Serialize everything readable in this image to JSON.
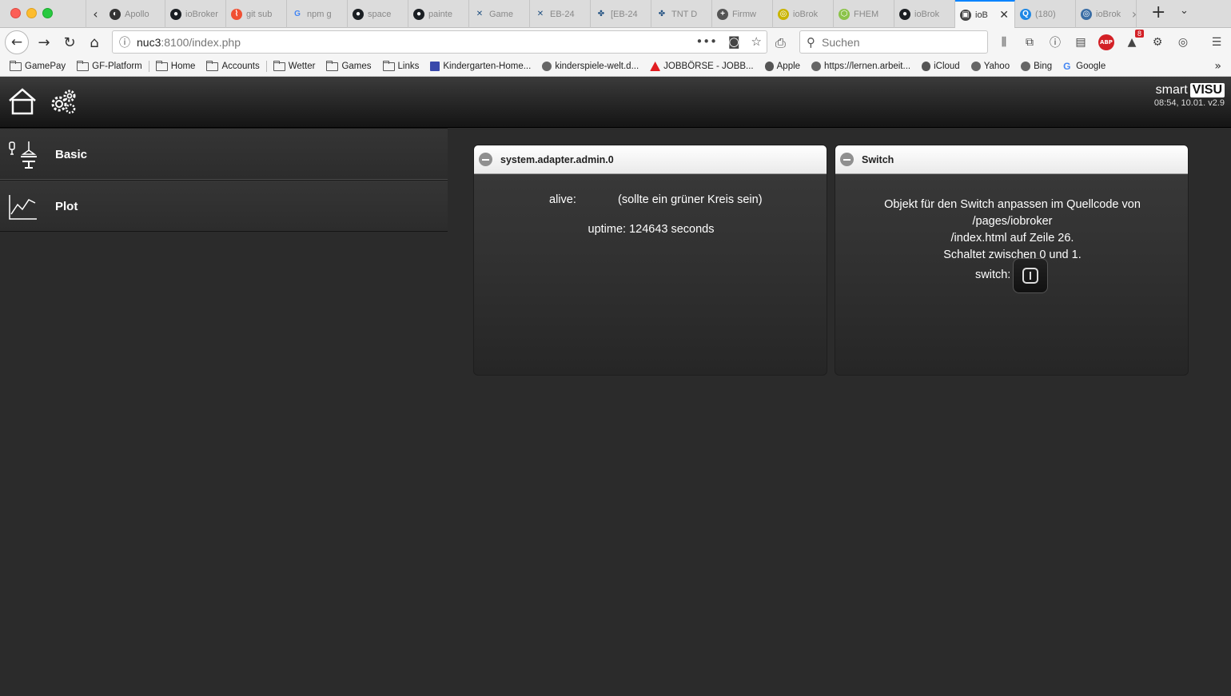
{
  "browser": {
    "tabs": [
      {
        "label": "Apollo",
        "icon": "apollo"
      },
      {
        "label": "ioBroker",
        "icon": "github"
      },
      {
        "label": "git sub",
        "icon": "git"
      },
      {
        "label": "npm g",
        "icon": "google"
      },
      {
        "label": "space",
        "icon": "github"
      },
      {
        "label": "painte",
        "icon": "github"
      },
      {
        "label": "Game",
        "icon": "confluence"
      },
      {
        "label": "EB-24",
        "icon": "confluence"
      },
      {
        "label": "[EB-24",
        "icon": "jira"
      },
      {
        "label": "TNT D",
        "icon": "jira"
      },
      {
        "label": "Firmw",
        "icon": "plus"
      },
      {
        "label": "ioBrok",
        "icon": "iobroker"
      },
      {
        "label": "FHEM",
        "icon": "fhem"
      },
      {
        "label": "ioBrok",
        "icon": "github"
      },
      {
        "label": "ioB",
        "icon": "visu",
        "active": true
      },
      {
        "label": "(180)",
        "icon": "iq"
      },
      {
        "label": "ioBrok",
        "icon": "iobroker-blue"
      }
    ],
    "url_host": "nuc3",
    "url_path": ":8100/index.php",
    "search_placeholder": "Suchen",
    "notification_count": "8",
    "abp_label": "ABP",
    "bookmarks": [
      {
        "label": "GamePay",
        "icon": "folder"
      },
      {
        "label": "GF-Platform",
        "icon": "folder"
      },
      {
        "label": "Home",
        "icon": "folder"
      },
      {
        "label": "Accounts",
        "icon": "folder"
      },
      {
        "label": "Wetter",
        "icon": "folder"
      },
      {
        "label": "Games",
        "icon": "folder"
      },
      {
        "label": "Links",
        "icon": "folder"
      },
      {
        "label": "Kindergarten-Home...",
        "icon": "site"
      },
      {
        "label": "kinderspiele-welt.d...",
        "icon": "globe"
      },
      {
        "label": "JOBBÖRSE - JOBB...",
        "icon": "arbeit"
      },
      {
        "label": "Apple",
        "icon": "apple"
      },
      {
        "label": "https://lernen.arbeit...",
        "icon": "globe"
      },
      {
        "label": "iCloud",
        "icon": "apple"
      },
      {
        "label": "Yahoo",
        "icon": "globe"
      },
      {
        "label": "Bing",
        "icon": "globe"
      },
      {
        "label": "Google",
        "icon": "g"
      }
    ]
  },
  "app": {
    "brand_smart": "smart",
    "brand_visu": "VISU",
    "version": "08:54, 10.01. v2.9",
    "nav": [
      {
        "label": "Basic",
        "icon": "lamp-icon"
      },
      {
        "label": "Plot",
        "icon": "chart-icon"
      }
    ],
    "widget1": {
      "title": "system.adapter.admin.0",
      "alive_label": "alive:",
      "alive_note": "(sollte ein grüner Kreis sein)",
      "uptime": "uptime: 124643 seconds"
    },
    "widget2": {
      "title": "Switch",
      "desc_line1": "Objekt für den Switch anpassen im Quellcode von /pages/iobroker",
      "desc_line2": "/index.html auf Zeile 26.",
      "desc_line3": "Schaltet zwischen 0 und 1.",
      "switch_label": "switch:"
    }
  }
}
